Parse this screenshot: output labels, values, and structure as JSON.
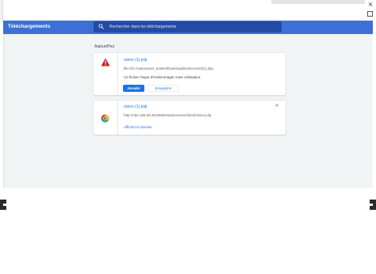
{
  "appbar": {
    "title": "Téléchargements",
    "search": {
      "placeholder": "Rechercher dans les téléchargements",
      "value": ""
    }
  },
  "section": {
    "date_header": "Aujourd'hui"
  },
  "downloads": [
    {
      "icon": "warning-triangle-icon",
      "file_name": "vision (1).jnlp",
      "location": "file:///C:/Users/user_sotelei/Downloads/vision%20(1).jnlp",
      "warning": "Ce fichier risque d'endommager votre ordinateur.",
      "primary_action": "Annuler",
      "secondary_action": "Enregistrer"
    },
    {
      "icon": "chrome-icon",
      "file_name": "vision (1).jnlp",
      "location": "http://192.168.60.48:8080/esa/services/client/vision.jnlp",
      "link_action": "Afficher le dossier",
      "remove_symbol": "×"
    }
  ],
  "window": {
    "close_symbol": "×"
  },
  "colors": {
    "appbar": "#3e6fd6",
    "search_box": "#244aa5",
    "content_bg": "#f1f3f4",
    "accent": "#1a73e8",
    "warning": "#c5221f"
  }
}
